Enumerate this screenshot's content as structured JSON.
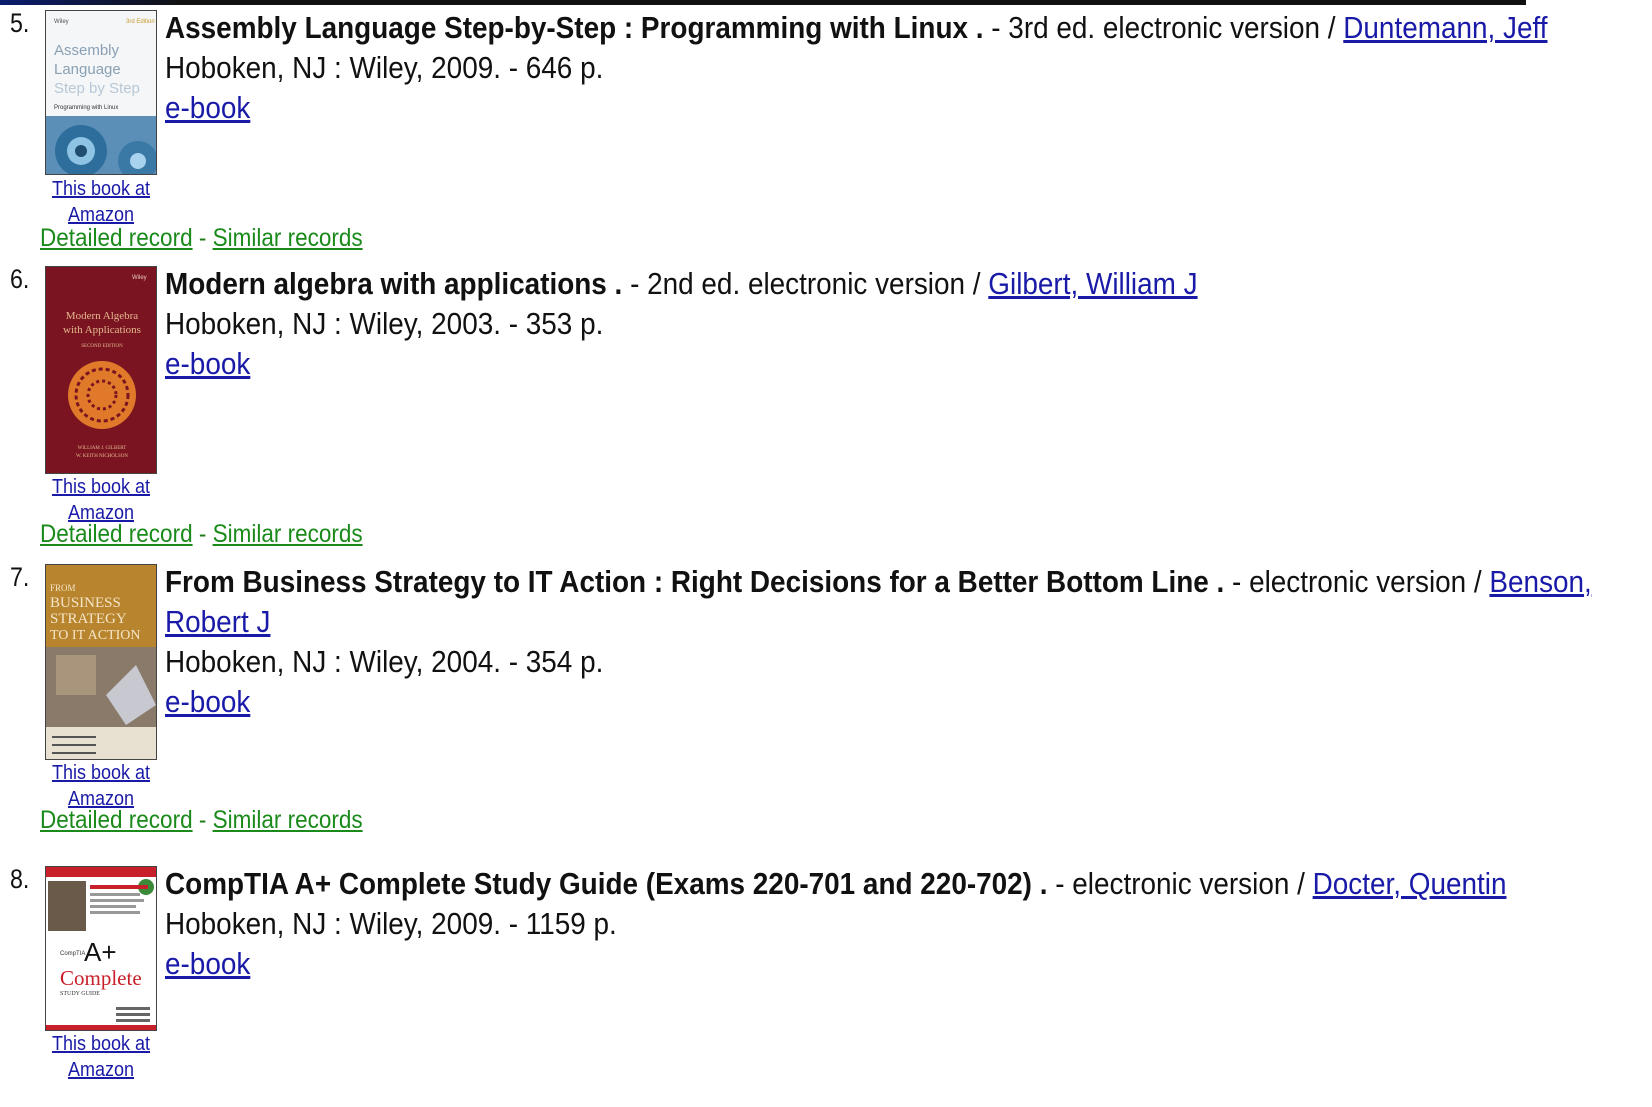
{
  "records": [
    {
      "number": "5.",
      "title": "Assembly Language Step-by-Step : Programming with Linux .",
      "edition": " - 3rd ed. electronic version / ",
      "author": "Duntemann, Jeff",
      "pub": "Hoboken, NJ : Wiley, 2009. - 646 p.",
      "ebook": "e-book",
      "amazon_line1": "This book at",
      "amazon_line2": "Amazon",
      "cover": {
        "line1": "Assembly",
        "line2": "Language",
        "line3": "Step by Step",
        "line4": "Programming with Linux"
      }
    },
    {
      "number": "6.",
      "title": "Modern algebra with applications .",
      "edition": " - 2nd ed. electronic version / ",
      "author": "Gilbert, William J",
      "pub": "Hoboken, NJ : Wiley, 2003. - 353 p.",
      "ebook": "e-book",
      "amazon_line1": "This book at",
      "amazon_line2": "Amazon",
      "cover": {
        "line1": "Modern Algebra",
        "line2": "with Applications",
        "line3": "SECOND EDITION",
        "line4": "WILLIAM J. GILBERT",
        "line5": "W. KEITH NICHOLSON"
      }
    },
    {
      "number": "7.",
      "title": "From Business Strategy to IT Action : Right Decisions for a Better Bottom Line .",
      "edition": " - electronic version / ",
      "author_part1": "Benson,",
      "author_part2": "Robert J",
      "pub": "Hoboken, NJ : Wiley, 2004. - 354 p.",
      "ebook": "e-book",
      "amazon_line1": "This book at",
      "amazon_line2": "Amazon",
      "cover": {
        "line1": "FROM",
        "line2": "BUSINESS",
        "line3": "STRATEGY",
        "line4": "TO IT ACTION",
        "line5": "RIGHT DECISIONS FOR A BETTER BOTTOM LINE"
      }
    },
    {
      "number": "8.",
      "title": "CompTIA A+ Complete Study Guide (Exams 220-701 and 220-702) .",
      "edition": " - electronic version / ",
      "author": "Docter, Quentin",
      "pub": "Hoboken, NJ : Wiley, 2009. - 1159 p.",
      "ebook": "e-book",
      "amazon_line1": "This book at",
      "amazon_line2": "Amazon",
      "cover": {
        "line1": "CompTIA",
        "line2": "A+",
        "line3": "Complete",
        "line4": "STUDY GUIDE"
      }
    }
  ],
  "links": {
    "detailed": "Detailed record",
    "separator": " - ",
    "similar": "Similar records"
  },
  "colors": {
    "link_blue": "#1a1aa8",
    "link_green": "#1a8a1a",
    "cover6_red": "#7a1420",
    "cover6_orange": "#e07a2a"
  }
}
